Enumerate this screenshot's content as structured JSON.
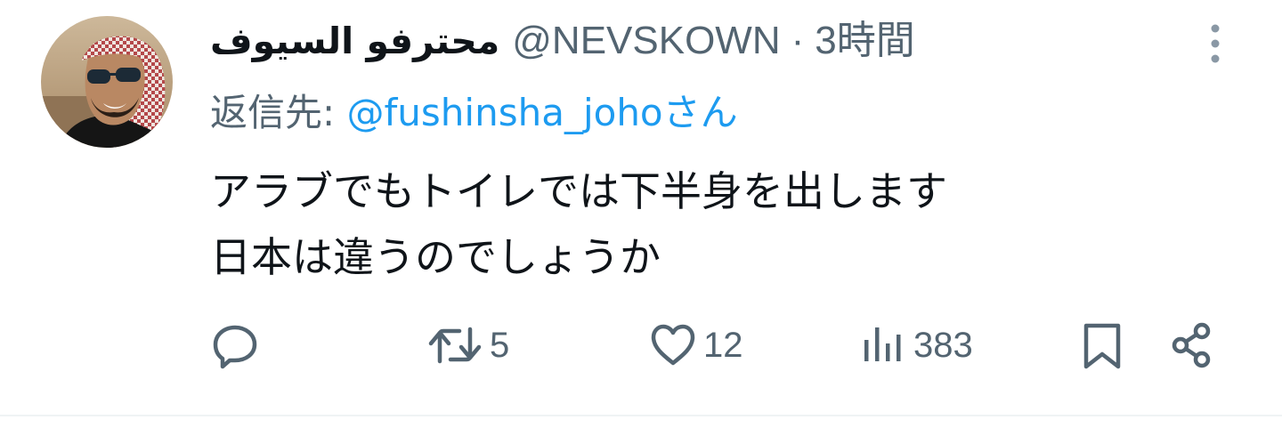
{
  "tweet": {
    "display_name": "محترفو السيوف",
    "handle": "@NEVSKOWN",
    "separator": "·",
    "time": "3時間",
    "reply_prefix": "返信先: ",
    "reply_mention": "@fushinsha_joho",
    "reply_suffix": "さん",
    "text_lines": [
      "アラブでもトイレでは下半身を出します",
      "日本は違うのでしょうか"
    ]
  },
  "actions": {
    "reply": {
      "icon": "reply-icon",
      "count": ""
    },
    "retweet": {
      "icon": "retweet-icon",
      "count": "5"
    },
    "like": {
      "icon": "heart-icon",
      "count": "12"
    },
    "views": {
      "icon": "views-icon",
      "count": "383"
    },
    "bookmark": {
      "icon": "bookmark-icon"
    },
    "share": {
      "icon": "share-icon"
    }
  },
  "colors": {
    "text": "#0f1419",
    "secondary": "#536471",
    "link": "#1d9bf0",
    "divider": "#eff3f4"
  }
}
